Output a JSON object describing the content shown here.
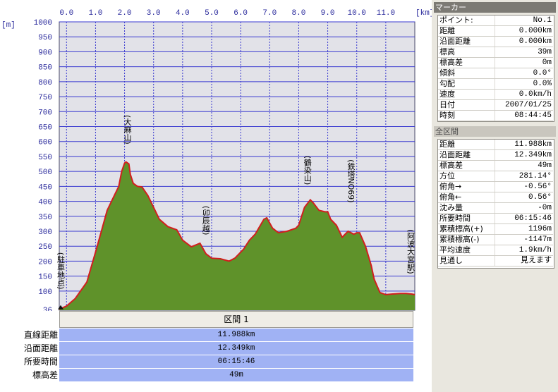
{
  "chart_data": {
    "type": "area",
    "x_unit": "[km]",
    "y_unit": "[m]",
    "x_ticks": [
      "0.0",
      "1.0",
      "2.0",
      "3.0",
      "4.0",
      "5.0",
      "6.0",
      "7.0",
      "8.0",
      "9.0",
      "10.0",
      "11.0"
    ],
    "y_ticks": [
      "1000",
      "950",
      "900",
      "850",
      "800",
      "750",
      "700",
      "650",
      "600",
      "550",
      "500",
      "450",
      "400",
      "350",
      "300",
      "250",
      "200",
      "150",
      "100"
    ],
    "y_min_label": "36",
    "xlim": [
      -0.25,
      12.0
    ],
    "ylim": [
      36,
      1000
    ],
    "series": [
      {
        "x": [
          -0.25,
          0.0,
          0.3,
          0.7,
          1.0,
          1.2,
          1.4,
          1.6,
          1.8,
          1.9,
          2.0,
          2.05,
          2.15,
          2.2,
          2.3,
          2.45,
          2.6,
          2.8,
          3.0,
          3.2,
          3.5,
          3.8,
          4.0,
          4.3,
          4.6,
          4.8,
          5.0,
          5.3,
          5.6,
          5.8,
          6.1,
          6.3,
          6.5,
          6.8,
          6.9,
          7.1,
          7.3,
          7.6,
          7.9,
          8.0,
          8.2,
          8.4,
          8.5,
          8.7,
          8.9,
          9.0,
          9.1,
          9.3,
          9.5,
          9.7,
          9.9,
          10.0,
          10.1,
          10.3,
          10.5,
          10.6,
          10.8,
          11.0,
          11.2,
          11.5,
          11.7,
          11.9,
          12.0
        ],
        "y": [
          39,
          50,
          75,
          130,
          230,
          300,
          370,
          410,
          450,
          500,
          528,
          532,
          525,
          490,
          460,
          450,
          448,
          420,
          380,
          340,
          315,
          305,
          270,
          248,
          260,
          225,
          210,
          208,
          200,
          210,
          240,
          270,
          290,
          340,
          345,
          310,
          295,
          300,
          310,
          320,
          380,
          405,
          395,
          370,
          365,
          365,
          340,
          320,
          280,
          300,
          290,
          295,
          295,
          250,
          185,
          140,
          95,
          88,
          90,
          92,
          92,
          90,
          88
        ]
      }
    ],
    "annotations": [
      {
        "label": "(大麻山)",
        "x": 2.1
      },
      {
        "label": "(卯辰越)",
        "x": 4.8
      },
      {
        "label": "(鶴染山)",
        "x": 8.3
      },
      {
        "label": "(鉄塔NO69)",
        "x": 9.8
      },
      {
        "label": "(駐車地点)",
        "x": -0.2
      },
      {
        "label": "(阿波大宮駅)",
        "x": 11.9
      }
    ],
    "fill_color": "#5f922a",
    "plot_bg": "#e2e2e8",
    "grid_color": "#3a3ad0"
  },
  "summary": {
    "section_label": "区間 1",
    "rows": [
      {
        "label": "直線距離",
        "value": "11.988km"
      },
      {
        "label": "沿面距離",
        "value": "12.349km"
      },
      {
        "label": "所要時間",
        "value": "06:15:46"
      },
      {
        "label": "標高差",
        "value": "49m"
      }
    ]
  },
  "marker_panel": {
    "title": "マーカー",
    "rows": [
      {
        "label": "ポイント:",
        "value": "No.1"
      },
      {
        "label": "距離",
        "value": "0.000km"
      },
      {
        "label": "沿面距離",
        "value": "0.000km"
      },
      {
        "label": "標高",
        "value": "39m"
      },
      {
        "label": "標高差",
        "value": "0m"
      },
      {
        "label": "傾斜",
        "value": "0.0°"
      },
      {
        "label": "勾配",
        "value": "0.0%"
      },
      {
        "label": "速度",
        "value": "0.0km/h"
      },
      {
        "label": "日付",
        "value": "2007/01/25"
      },
      {
        "label": "時刻",
        "value": "08:44:45"
      }
    ]
  },
  "section_panel": {
    "title": "全区間",
    "rows": [
      {
        "label": "距離",
        "value": "11.988km"
      },
      {
        "label": "沿面距離",
        "value": "12.349km"
      },
      {
        "label": "標高差",
        "value": "49m"
      },
      {
        "label": "方位",
        "value": "281.14°"
      },
      {
        "label": "俯角→",
        "value": "-0.56°"
      },
      {
        "label": "俯角←",
        "value": "0.56°"
      },
      {
        "label": "沈み量",
        "value": "-0m"
      },
      {
        "label": "所要時間",
        "value": "06:15:46"
      },
      {
        "label": "累積標高(+)",
        "value": "1196m"
      },
      {
        "label": "累積標高(-)",
        "value": "-1147m"
      },
      {
        "label": "平均速度",
        "value": "1.9km/h"
      },
      {
        "label": "見通し",
        "value": "見えます"
      }
    ]
  }
}
